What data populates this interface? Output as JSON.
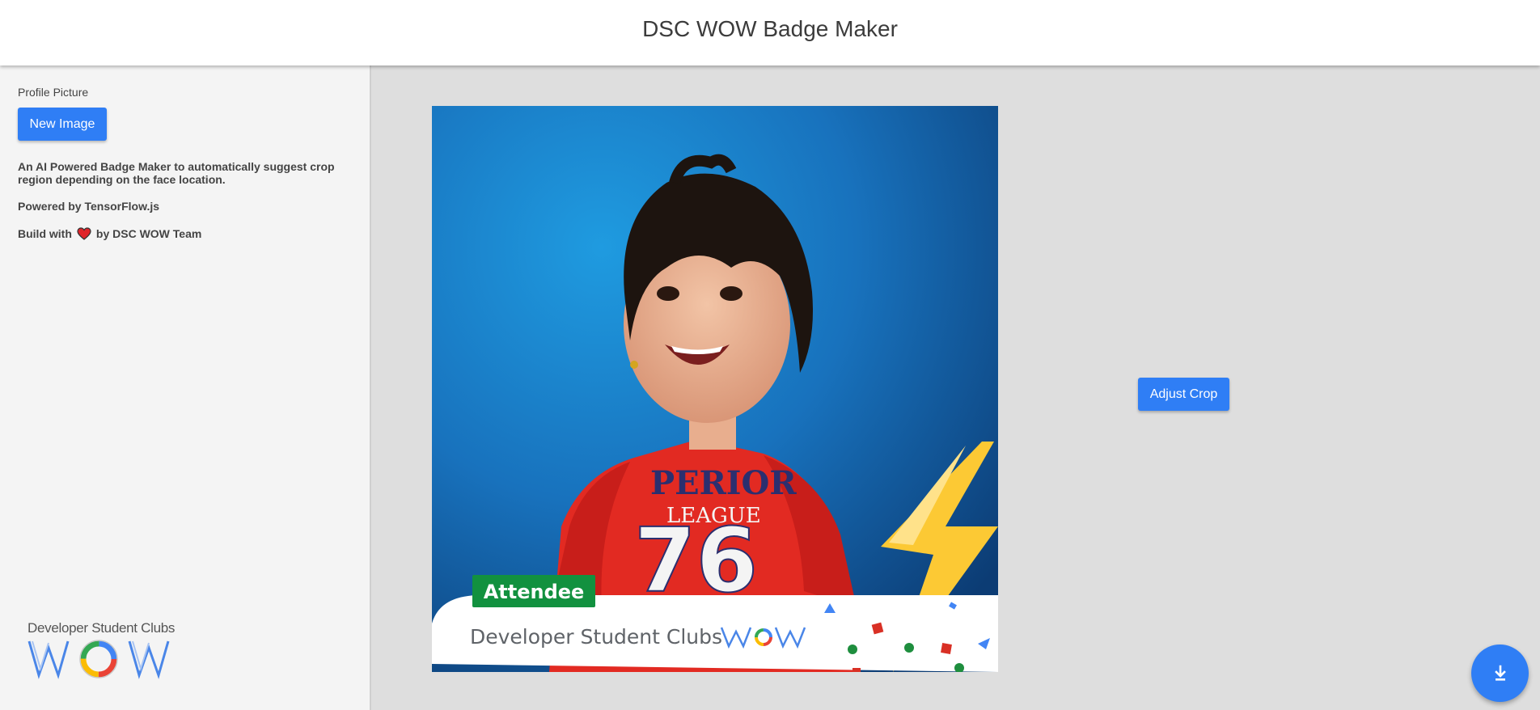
{
  "header": {
    "title": "DSC WOW Badge Maker"
  },
  "sidebar": {
    "profile_label": "Profile Picture",
    "new_image_label": "New Image",
    "description": "An AI Powered Badge Maker to automatically suggest crop region depending on the face location.",
    "powered_by": "Powered by TensorFlow.js",
    "build_prefix": "Build with",
    "build_suffix": "by DSC WOW Team",
    "heart_icon": "heart-icon",
    "logo_caption": "Developer Student Clubs",
    "logo_word": "WOW"
  },
  "badge": {
    "role_label": "Attendee",
    "footer_text": "Developer Student Clubs",
    "footer_word": "WOW",
    "accent": "#12913f",
    "bolt_color": "#fcc934"
  },
  "actions": {
    "adjust_crop_label": "Adjust Crop",
    "download_icon": "download-icon"
  },
  "colors": {
    "primary": "#2f7ef5",
    "sidebar_bg": "#f4f4f4",
    "main_bg": "#dedede"
  }
}
